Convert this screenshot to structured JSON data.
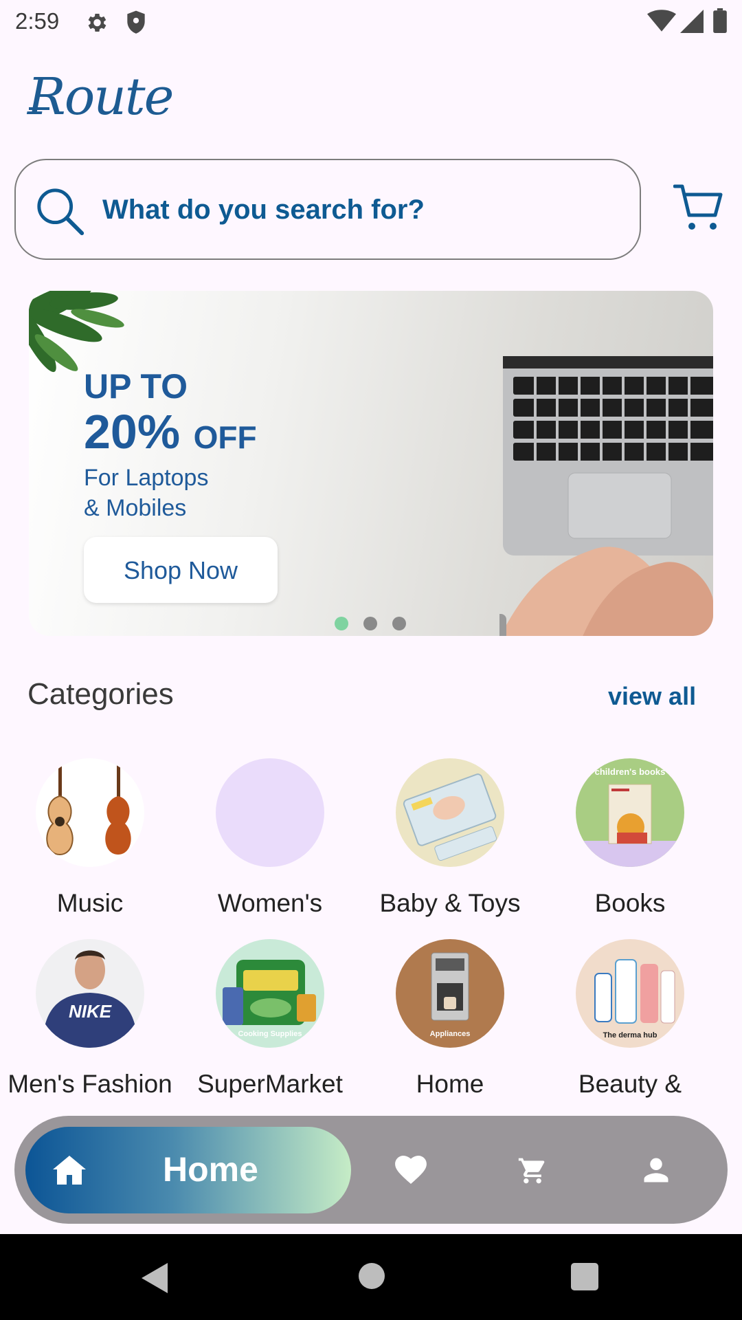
{
  "status_bar": {
    "time": "2:59"
  },
  "header": {
    "logo_text": "Route"
  },
  "search": {
    "placeholder": "What do you search for?"
  },
  "banner": {
    "line1": "UP TO",
    "line2_big": "20%",
    "line2_off": "OFF",
    "line3": "For Laptops",
    "line4": "& Mobiles",
    "button_label": "Shop Now",
    "page_count": 3,
    "active_page": 1
  },
  "categories": {
    "title": "Categories",
    "view_all": "view all",
    "items": [
      {
        "label": "Music"
      },
      {
        "label": "Women's"
      },
      {
        "label": "Baby & Toys"
      },
      {
        "label": "Books",
        "image_text": "children's books"
      },
      {
        "label": "Men's Fashion",
        "image_text": "NIKE"
      },
      {
        "label": "SuperMarket",
        "image_text": "Cooking Supplies"
      },
      {
        "label": "Home",
        "image_text": "Appliances"
      },
      {
        "label": "Beauty &",
        "image_text": "The derma hub"
      }
    ]
  },
  "bottom_nav": {
    "active_label": "Home",
    "items": [
      "home-icon",
      "heart-icon",
      "cart-icon",
      "person-icon"
    ]
  },
  "colors": {
    "accent": "#0e5a92",
    "background": "#FEF7FF",
    "nav_bar": "#9a969a",
    "dot_active": "#7fd3a0"
  }
}
